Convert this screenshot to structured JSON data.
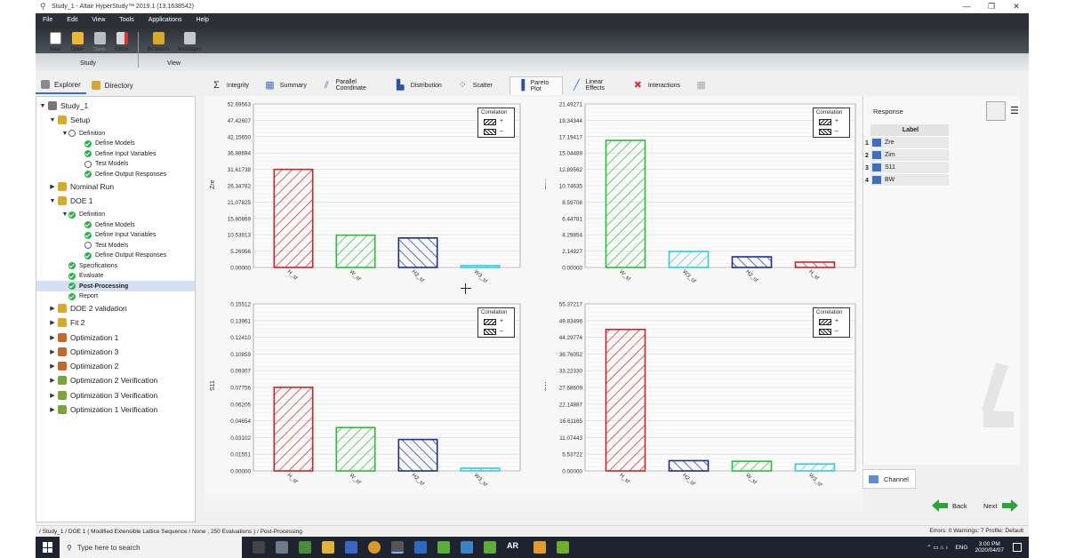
{
  "window": {
    "title": "Study_1 - Altair HyperStudy™ 2019.1 (13.1638542)",
    "controls": [
      "—",
      "❐",
      "✕"
    ]
  },
  "menu": [
    "File",
    "Edit",
    "View",
    "Tools",
    "Applications",
    "Help"
  ],
  "ribbon": {
    "study_buttons": [
      "New",
      "Open",
      "Save",
      "Close"
    ],
    "study_group": "Study",
    "view_buttons": [
      "Browsers",
      "Messages"
    ],
    "view_group": "View"
  },
  "explorer_tabs": [
    "Explorer",
    "Directory"
  ],
  "tree": [
    {
      "label": "Study_1",
      "level": 0,
      "arrow": "▼",
      "icon": "microscope"
    },
    {
      "label": "Setup",
      "level": 1,
      "arrow": "▼",
      "icon": "setup"
    },
    {
      "label": "Definition",
      "level": 2,
      "arrow": "▼",
      "icon": "circle"
    },
    {
      "label": "Define Models",
      "level": 3,
      "icon": "check"
    },
    {
      "label": "Define Input Variables",
      "level": 3,
      "icon": "check"
    },
    {
      "label": "Test Models",
      "level": 3,
      "icon": "circle"
    },
    {
      "label": "Define Output Responses",
      "level": 3,
      "icon": "check"
    },
    {
      "label": "Nominal Run",
      "level": 1,
      "arrow": "▶",
      "icon": "run"
    },
    {
      "label": "DOE 1",
      "level": 1,
      "arrow": "▼",
      "icon": "doe"
    },
    {
      "label": "Definition",
      "level": 2,
      "arrow": "▼",
      "icon": "check"
    },
    {
      "label": "Define Models",
      "level": 3,
      "icon": "check"
    },
    {
      "label": "Define Input Variables",
      "level": 3,
      "icon": "check"
    },
    {
      "label": "Test Models",
      "level": 3,
      "icon": "circle"
    },
    {
      "label": "Define Output Responses",
      "level": 3,
      "icon": "check"
    },
    {
      "label": "Specifications",
      "level": 2,
      "icon": "check"
    },
    {
      "label": "Evaluate",
      "level": 2,
      "icon": "check"
    },
    {
      "label": "Post-Processing",
      "level": 2,
      "icon": "check",
      "selected": true
    },
    {
      "label": "Report",
      "level": 2,
      "icon": "check"
    },
    {
      "label": "DOE 2 validation",
      "level": 1,
      "arrow": "▶",
      "icon": "doe"
    },
    {
      "label": "Fit 2",
      "level": 1,
      "arrow": "▶",
      "icon": "fit"
    },
    {
      "label": "Optimization 1",
      "level": 1,
      "arrow": "▶",
      "icon": "opt"
    },
    {
      "label": "Optimization 3",
      "level": 1,
      "arrow": "▶",
      "icon": "opt"
    },
    {
      "label": "Optimization 2",
      "level": 1,
      "arrow": "▶",
      "icon": "opt"
    },
    {
      "label": "Optimization 2 Verification",
      "level": 1,
      "arrow": "▶",
      "icon": "ver"
    },
    {
      "label": "Optimization 3 Verification",
      "level": 1,
      "arrow": "▶",
      "icon": "ver"
    },
    {
      "label": "Optimization 1 Verification",
      "level": 1,
      "arrow": "▶",
      "icon": "ver"
    }
  ],
  "tabs": [
    {
      "label": "Integrity",
      "icon": "sigma-icon"
    },
    {
      "label": "Summary",
      "icon": "table-icon"
    },
    {
      "label": "Parallel Coordinate",
      "icon": "parallel-icon"
    },
    {
      "label": "Distribution",
      "icon": "histogram-icon"
    },
    {
      "label": "Scatter",
      "icon": "scatter-icon"
    },
    {
      "label": "Pareto Plot",
      "icon": "pareto-icon",
      "active": true
    },
    {
      "label": "Linear Effects",
      "icon": "line-icon"
    },
    {
      "label": "Interactions",
      "icon": "interactions-icon"
    },
    {
      "label": "",
      "icon": "grid-icon"
    }
  ],
  "legend": {
    "title": "Correlation",
    "pos": "+",
    "neg": "–"
  },
  "colors": {
    "red": "#c8262a",
    "green": "#2dbb3e",
    "navy": "#1c2f8c",
    "cyan": "#38c9e3",
    "selected": "#d5e1f2"
  },
  "chart_data": [
    {
      "type": "bar",
      "ylabel": "Zre",
      "ylim": [
        0,
        52.69563
      ],
      "ticks": [
        "0.00000",
        "5.26956",
        "10.53913",
        "15.80869",
        "21.07825",
        "26.34782",
        "31.61738",
        "36.88694",
        "42.15650",
        "47.42607",
        "52.69563"
      ],
      "categories": [
        "H_sf",
        "W_sf",
        "H2_sf",
        "W3_sf"
      ],
      "values": [
        31.6,
        10.4,
        9.5,
        0.6
      ],
      "correlation": [
        "+",
        "+",
        "-",
        "+"
      ],
      "colors": [
        "red",
        "green",
        "navy",
        "cyan"
      ]
    },
    {
      "type": "bar",
      "ylabel": "Zim",
      "ylim": [
        0,
        21.49271
      ],
      "ticks": [
        "0.00000",
        "2.14927",
        "4.29854",
        "6.44781",
        "8.59708",
        "10.74635",
        "12.89562",
        "15.04489",
        "17.19417",
        "19.34344",
        "21.49271"
      ],
      "categories": [
        "W_sf",
        "W3_sf",
        "H2_sf",
        "H_sf"
      ],
      "values": [
        16.7,
        2.1,
        1.4,
        0.7
      ],
      "correlation": [
        "+",
        "+",
        "-",
        "-"
      ],
      "colors": [
        "green",
        "cyan",
        "navy",
        "red"
      ]
    },
    {
      "type": "bar",
      "ylabel": "S11",
      "ylim": [
        0,
        0.15512
      ],
      "ticks": [
        "0.00000",
        "0.01551",
        "0.03102",
        "0.04654",
        "0.06205",
        "0.07756",
        "0.09307",
        "0.10859",
        "0.12410",
        "0.13961",
        "0.15512"
      ],
      "categories": [
        "H_sf",
        "W_sf",
        "H2_sf",
        "W3_sf"
      ],
      "values": [
        0.0776,
        0.0403,
        0.0292,
        0.0025
      ],
      "correlation": [
        "+",
        "+",
        "-",
        "+"
      ],
      "colors": [
        "red",
        "green",
        "navy",
        "cyan"
      ]
    },
    {
      "type": "bar",
      "ylabel": "BW",
      "ylim": [
        0,
        55.37217
      ],
      "ticks": [
        "0.00000",
        "5.53722",
        "11.07443",
        "16.61165",
        "22.14887",
        "27.68609",
        "33.22330",
        "38.76052",
        "44.29774",
        "49.83496",
        "55.37217"
      ],
      "categories": [
        "H_sf",
        "H2_sf",
        "W_sf",
        "W3_sf"
      ],
      "values": [
        46.9,
        3.4,
        3.2,
        2.3
      ],
      "correlation": [
        "+",
        "-",
        "+",
        "+"
      ],
      "colors": [
        "red",
        "navy",
        "green",
        "cyan"
      ]
    }
  ],
  "response_panel": {
    "label": "Response",
    "header": "Label",
    "rows": [
      {
        "num": "1",
        "label": "Zre"
      },
      {
        "num": "2",
        "label": "Zim"
      },
      {
        "num": "3",
        "label": "S11"
      },
      {
        "num": "4",
        "label": "BW"
      }
    ]
  },
  "channel_tab": "Channel",
  "nav": {
    "back": "Back",
    "next": "Next"
  },
  "status": {
    "path": "/ Study_1 / DOE 1 ( Modified Extensible Lattice Sequence / None , 250 Evaluations ) / Post-Processing",
    "right": "Errors: 0   Warnings: 7      Profile: Default"
  },
  "taskbar": {
    "search": "Type here to search",
    "time": "3:00 PM",
    "date": "2020/04/07",
    "lang": "ENG",
    "ar": "AR"
  }
}
